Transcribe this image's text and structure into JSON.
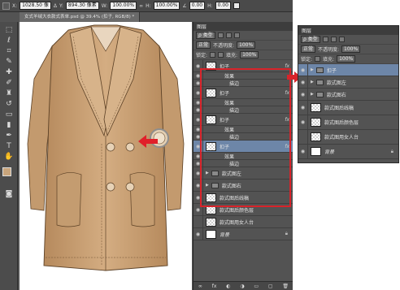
{
  "options_bar": {
    "x_label": "X:",
    "x_value": "1028.50 像",
    "y_label": "Y:",
    "y_value": "894.30 像素",
    "w_label": "W:",
    "w_value": "100.00%",
    "h_label": "H:",
    "h_value": "100.00%",
    "angle_value": "0.00",
    "h2_label": "H:",
    "h2_value": "0.00"
  },
  "document_tab": "女式羊绒大衣款式表单.psd @ 39.4% (扣子, RGB/8) *",
  "layers_panel": {
    "tabs": [
      "图层"
    ],
    "kind_label": "ρ 类型",
    "blend_mode": "正常",
    "opacity_label": "不透明度:",
    "opacity_value": "100%",
    "lock_label": "锁定:",
    "fill_label": "填充:",
    "fill_value": "100%",
    "layers": [
      {
        "name": "扣子",
        "fx": "fx",
        "effects_label": "效果",
        "effect": "描边"
      },
      {
        "name": "扣子",
        "fx": "fx",
        "effects_label": "效果",
        "effect": "描边"
      },
      {
        "name": "扣子",
        "fx": "fx",
        "effects_label": "效果",
        "effect": "描边"
      },
      {
        "name": "扣子",
        "fx": "fx",
        "effects_label": "效果",
        "effect": "描边"
      }
    ],
    "groups": [
      "款式图左",
      "款式图右"
    ],
    "plain_layers": [
      "款式图后线稿",
      "款式图后颜色层",
      "款式图用女人台"
    ],
    "background_layer": "背景"
  },
  "mini_panel": {
    "title": "图层",
    "kind_label": "ρ 类型",
    "blend_mode": "正常",
    "opacity_label": "不透明度:",
    "opacity_value": "100%",
    "lock_label": "锁定:",
    "fill_label": "填充:",
    "fill_value": "100%",
    "groups": [
      "扣子",
      "款式图左",
      "款式图右"
    ],
    "plain_layers": [
      "款式图后线稿",
      "款式图后颜色层",
      "款式图用女人台"
    ],
    "background_layer": "背景"
  },
  "colors": {
    "coat_main": "#cfa67b",
    "coat_shadow": "#b98b5e",
    "highlight_red": "#d8232a",
    "selected_layer": "#6d86a8"
  }
}
